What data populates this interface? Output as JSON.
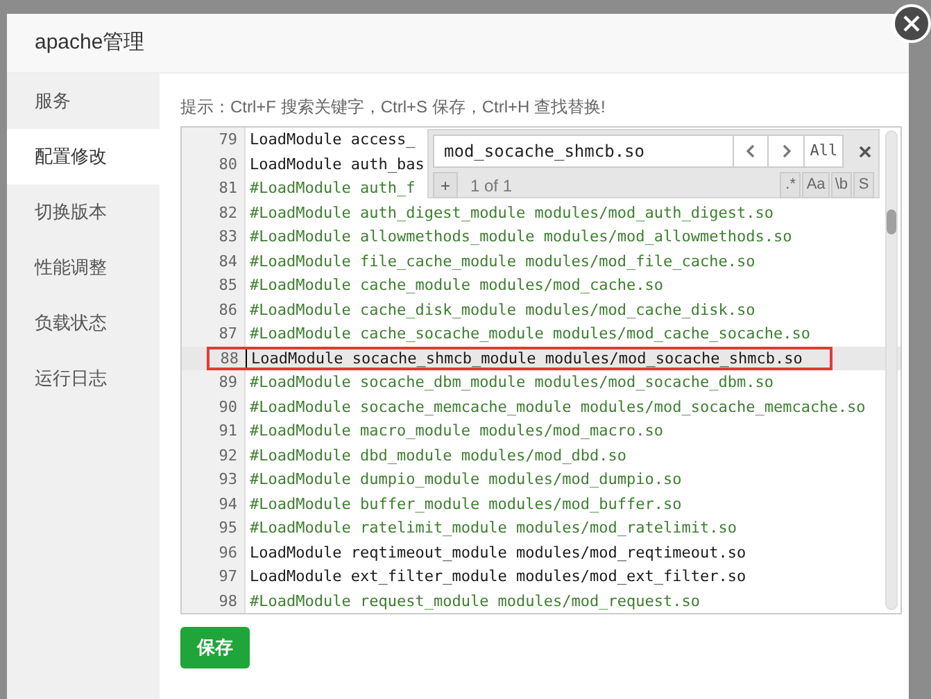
{
  "dialog": {
    "title": "apache管理",
    "sidebar": [
      {
        "label": "服务",
        "selected": false
      },
      {
        "label": "配置修改",
        "selected": true
      },
      {
        "label": "切换版本",
        "selected": false
      },
      {
        "label": "性能调整",
        "selected": false
      },
      {
        "label": "负载状态",
        "selected": false
      },
      {
        "label": "运行日志",
        "selected": false
      }
    ],
    "hint": "提示：Ctrl+F 搜索关键字，Ctrl+S 保存，Ctrl+H 查找替换!",
    "editor": {
      "lines": [
        {
          "number": "79",
          "text": "LoadModule access_",
          "kind": "directive",
          "highlighted": false
        },
        {
          "number": "80",
          "text": "LoadModule auth_bas",
          "kind": "directive",
          "highlighted": false
        },
        {
          "number": "81",
          "text": "#LoadModule auth_f",
          "kind": "comment",
          "highlighted": false
        },
        {
          "number": "82",
          "text": "#LoadModule auth_digest_module modules/mod_auth_digest.so",
          "kind": "comment",
          "highlighted": false
        },
        {
          "number": "83",
          "text": "#LoadModule allowmethods_module modules/mod_allowmethods.so",
          "kind": "comment",
          "highlighted": false
        },
        {
          "number": "84",
          "text": "#LoadModule file_cache_module modules/mod_file_cache.so",
          "kind": "comment",
          "highlighted": false
        },
        {
          "number": "85",
          "text": "#LoadModule cache_module modules/mod_cache.so",
          "kind": "comment",
          "highlighted": false
        },
        {
          "number": "86",
          "text": "#LoadModule cache_disk_module modules/mod_cache_disk.so",
          "kind": "comment",
          "highlighted": false
        },
        {
          "number": "87",
          "text": "#LoadModule cache_socache_module modules/mod_cache_socache.so",
          "kind": "comment",
          "highlighted": false
        },
        {
          "number": "88",
          "text": "LoadModule socache_shmcb_module modules/mod_socache_shmcb.so",
          "kind": "directive",
          "highlighted": true
        },
        {
          "number": "89",
          "text": "#LoadModule socache_dbm_module modules/mod_socache_dbm.so",
          "kind": "comment",
          "highlighted": false
        },
        {
          "number": "90",
          "text": "#LoadModule socache_memcache_module modules/mod_socache_memcache.so",
          "kind": "comment",
          "highlighted": false
        },
        {
          "number": "91",
          "text": "#LoadModule macro_module modules/mod_macro.so",
          "kind": "comment",
          "highlighted": false
        },
        {
          "number": "92",
          "text": "#LoadModule dbd_module modules/mod_dbd.so",
          "kind": "comment",
          "highlighted": false
        },
        {
          "number": "93",
          "text": "#LoadModule dumpio_module modules/mod_dumpio.so",
          "kind": "comment",
          "highlighted": false
        },
        {
          "number": "94",
          "text": "#LoadModule buffer_module modules/mod_buffer.so",
          "kind": "comment",
          "highlighted": false
        },
        {
          "number": "95",
          "text": "#LoadModule ratelimit_module modules/mod_ratelimit.so",
          "kind": "comment",
          "highlighted": false
        },
        {
          "number": "96",
          "text": "LoadModule reqtimeout_module modules/mod_reqtimeout.so",
          "kind": "directive",
          "highlighted": false
        },
        {
          "number": "97",
          "text": "LoadModule ext_filter_module modules/mod_ext_filter.so",
          "kind": "directive",
          "highlighted": false
        },
        {
          "number": "98",
          "text": "#LoadModule request_module modules/mod_request.so",
          "kind": "comment",
          "highlighted": false
        }
      ],
      "search": {
        "value": "mod_socache_shmcb.so",
        "all_button": "All",
        "add_button": "+",
        "match_count": "1 of 1",
        "options": [
          ".*",
          "Aa",
          "\\b",
          "S"
        ]
      }
    },
    "save_button": "保存"
  }
}
